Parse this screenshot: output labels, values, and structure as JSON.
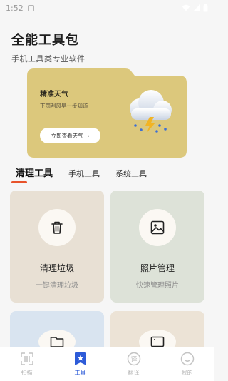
{
  "status_bar": {
    "time": "1:52"
  },
  "header": {
    "title": "全能工具包",
    "subtitle": "手机工具类专业软件"
  },
  "weather_card": {
    "title": "精准天气",
    "description": "下雨刮风早一步知道",
    "button_label": "立即查看天气 →",
    "icon": "thunderstorm-cloud-icon"
  },
  "tabs": [
    {
      "label": "清理工具",
      "active": true
    },
    {
      "label": "手机工具",
      "active": false
    },
    {
      "label": "系统工具",
      "active": false
    }
  ],
  "tools": [
    {
      "name": "清理垃圾",
      "desc": "一键清理垃圾",
      "icon": "trash-icon",
      "color": "#e8e0d4"
    },
    {
      "name": "照片管理",
      "desc": "快速管理照片",
      "icon": "image-icon",
      "color": "#dde2d8"
    },
    {
      "name": "",
      "desc": "",
      "icon": "folder-icon",
      "color": "#d9e4f0"
    },
    {
      "name": "",
      "desc": "",
      "icon": "screen-icon",
      "color": "#ece3d6"
    }
  ],
  "bottom_nav": [
    {
      "label": "扫描",
      "icon": "scan-icon",
      "active": false
    },
    {
      "label": "工具",
      "icon": "toolbox-icon",
      "active": true
    },
    {
      "label": "翻译",
      "icon": "translate-icon",
      "active": false
    },
    {
      "label": "我的",
      "icon": "profile-icon",
      "active": false
    }
  ],
  "colors": {
    "accent": "#e8532b",
    "nav_active": "#2d5bd8",
    "weather_card": "#dcc87c"
  }
}
